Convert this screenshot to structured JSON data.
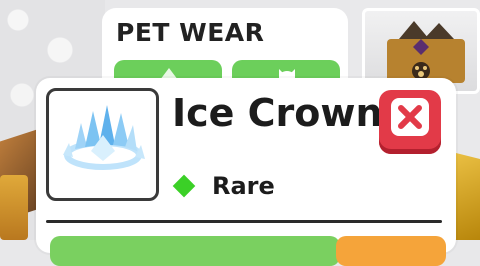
{
  "panel": {
    "title": "PET WEAR",
    "buttons": [
      {
        "icon": "arrow-up-icon"
      },
      {
        "icon": "cat-face-icon"
      }
    ]
  },
  "item": {
    "name": "Ice Crown",
    "rarity": "Rare",
    "rarity_color": "#3bd027",
    "thumbnail_icon": "ice-crown-icon"
  },
  "close_button": {
    "icon": "close-icon",
    "color": "#e23a48"
  },
  "colors": {
    "primary_button": "#6ccf5b",
    "secondary_button": "#f5a43a"
  }
}
